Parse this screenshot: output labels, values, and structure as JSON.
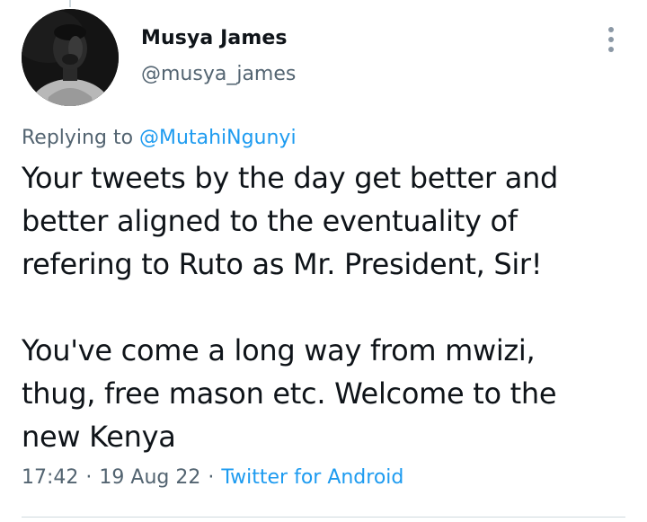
{
  "author": {
    "display_name": "Musya James",
    "handle": "@musya_james",
    "avatar_icon": "avatar-photo"
  },
  "reply": {
    "prefix": "Replying to",
    "mention": "@MutahiNgunyi"
  },
  "tweet": {
    "lines": [
      "Your tweets by the day get better and",
      "better aligned to the eventuality of",
      "refering to Ruto as Mr. President, Sir!",
      "You've come a long way from mwizi,",
      "thug, free mason etc. Welcome to the",
      "new Kenya"
    ]
  },
  "meta": {
    "time": "17:42",
    "separator": "·",
    "date": "19 Aug 22",
    "source": "Twitter for Android"
  },
  "colors": {
    "text": "#0f1419",
    "secondary": "#536471",
    "link": "#1d9bf0"
  },
  "icons": {
    "more": "more-vertical-icon"
  }
}
